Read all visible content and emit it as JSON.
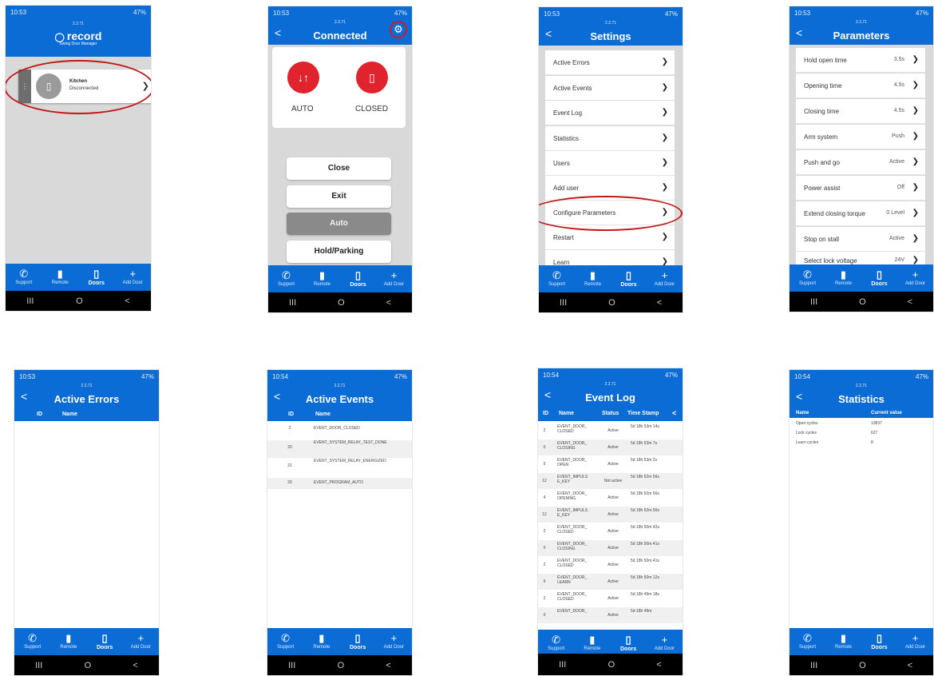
{
  "status_bar": {
    "time_a": "10:53",
    "time_b": "10:54",
    "right": "47%"
  },
  "version": "2.2.71",
  "nav": [
    {
      "label": "Support",
      "icon": "phone-icon"
    },
    {
      "label": "Remote",
      "icon": "remote-icon"
    },
    {
      "label": "Doors",
      "icon": "door-icon"
    },
    {
      "label": "Add Door",
      "icon": "plus-icon"
    }
  ],
  "sysnav": {
    "recents": "III",
    "home": "O",
    "back": "<"
  },
  "screen1": {
    "logo": "record",
    "subtitle": "Swing Door Manager",
    "door": {
      "name": "Kitchen",
      "status": "Disconnected"
    }
  },
  "screen2": {
    "title": "Connected",
    "modes": [
      {
        "label": "AUTO"
      },
      {
        "label": "CLOSED"
      }
    ],
    "buttons": [
      "Close",
      "Exit",
      "Auto",
      "Hold/Parking"
    ]
  },
  "screen3": {
    "title": "Settings",
    "items": [
      "Active Errors",
      "Active Events",
      "Event Log",
      "Statistics",
      "Users",
      "Add user",
      "Configure Parameters",
      "Restart",
      "Learn"
    ]
  },
  "screen4": {
    "title": "Parameters",
    "items": [
      {
        "label": "Hold open time",
        "value": "3.5s"
      },
      {
        "label": "Opening time",
        "value": "4.5s"
      },
      {
        "label": "Closing time",
        "value": "4.5s"
      },
      {
        "label": "Arm system",
        "value": "Push"
      },
      {
        "label": "Push and go",
        "value": "Active"
      },
      {
        "label": "Power assist",
        "value": "Off"
      },
      {
        "label": "Extend closing torque",
        "value": "0 Level"
      },
      {
        "label": "Stop on stall",
        "value": "Active"
      },
      {
        "label": "Select lock voltage",
        "value": "24V"
      }
    ]
  },
  "screen5": {
    "title": "Active Errors",
    "col_id": "ID",
    "col_name": "Name"
  },
  "screen6": {
    "title": "Active Events",
    "col_id": "ID",
    "col_name": "Name",
    "rows": [
      {
        "id": "2",
        "name": "EVENT_DOOR_CLOSED"
      },
      {
        "id": "20",
        "name": "EVENT_SYSTEM_RELAY_TEST_DONE"
      },
      {
        "id": "21",
        "name": "EVENT_SYSTEM_RELAY_ENERGIZED"
      },
      {
        "id": "29",
        "name": "EVENT_PROGRAM_AUTO"
      }
    ]
  },
  "screen7": {
    "title": "Event Log",
    "cols": {
      "id": "ID",
      "name": "Name",
      "status": "Status",
      "time": "Time Stamp"
    },
    "rows": [
      {
        "id": "2",
        "name": "EVENT_DOOR_ CLOSED",
        "status": "Active",
        "time": "5d 18h 53m 14s"
      },
      {
        "id": "0",
        "name": "EVENT_DOOR_ CLOSING",
        "status": "Active",
        "time": "5d 18h 53m 7s"
      },
      {
        "id": "5",
        "name": "EVENT_DOOR_ OPEN",
        "status": "Active",
        "time": "5d 18h 53m 2s"
      },
      {
        "id": "12",
        "name": "EVENT_IMPULS E_KEY",
        "status": "Not active",
        "time": "5d 18h 52m 56s"
      },
      {
        "id": "4",
        "name": "EVENT_DOOR_ OPENING",
        "status": "Active",
        "time": "5d 18h 52m 56s"
      },
      {
        "id": "12",
        "name": "EVENT_IMPULS E_KEY",
        "status": "Active",
        "time": "5d 18h 52m 56s"
      },
      {
        "id": "2",
        "name": "EVENT_DOOR_ CLOSED",
        "status": "Active",
        "time": "5d 18h 50m 42s"
      },
      {
        "id": "0",
        "name": "EVENT_DOOR_ CLOSING",
        "status": "Active",
        "time": "5d 18h 50m 41s"
      },
      {
        "id": "2",
        "name": "EVENT_DOOR_ CLOSED",
        "status": "Active",
        "time": "5d 18h 50m 41s"
      },
      {
        "id": "9",
        "name": "EVENT_DOOR_ LEARN",
        "status": "Active",
        "time": "5d 18h 50m 12s"
      },
      {
        "id": "2",
        "name": "EVENT_DOOR_ CLOSED",
        "status": "Active",
        "time": "5d 18h 49m 18s"
      },
      {
        "id": "0",
        "name": "EVENT_DOOR_",
        "status": "Active",
        "time": "5d 18h 49m"
      }
    ]
  },
  "screen8": {
    "title": "Statistics",
    "col_name": "Name",
    "col_value": "Current value",
    "rows": [
      {
        "name": "Open cycles",
        "value": "10837"
      },
      {
        "name": "Lock cycles",
        "value": "627"
      },
      {
        "name": "Learn cycles",
        "value": "8"
      }
    ]
  },
  "colors": {
    "header": "#0b6cd6",
    "accent_red": "#e0232d",
    "highlight_ellipse": "#c31818"
  }
}
